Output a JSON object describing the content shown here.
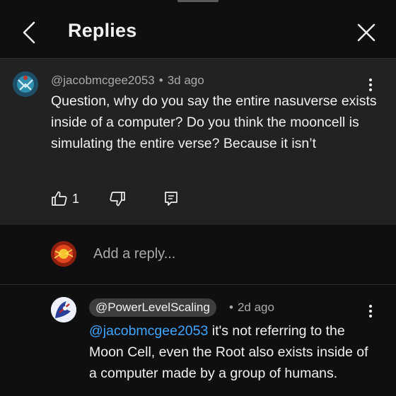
{
  "header": {
    "title": "Replies"
  },
  "comment": {
    "author": "@jacobmcgee2053",
    "separator": "•",
    "time": "3d ago",
    "text": "Question, why do you say the entire nasuverse exists inside of a computer? Do you think the mooncell is simulating the entire verse? Because it isn’t",
    "like_count": "1"
  },
  "add_reply": {
    "placeholder": "Add a reply..."
  },
  "reply": {
    "author": "@PowerLevelScaling",
    "separator": "•",
    "time": "2d ago",
    "mention": "@jacobmcgee2053",
    "text": " it's not referring to the Moon Cell, even the Root also exists inside of a computer made by a group of humans."
  },
  "icons": {
    "back": "chevron-left-icon",
    "close": "close-icon",
    "like": "thumbs-up-icon",
    "dislike": "thumbs-down-icon",
    "reply": "comment-reply-icon",
    "more": "more-vertical-icon"
  },
  "colors": {
    "background": "#0f0f0f",
    "highlighted_comment": "#222222",
    "mention": "#3ea6ff",
    "secondary_text": "#aaaaaa"
  }
}
